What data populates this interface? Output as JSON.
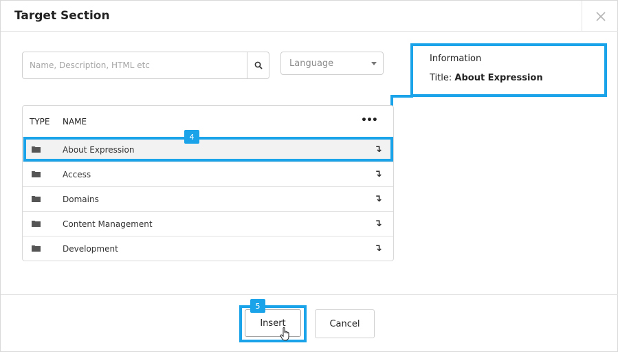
{
  "dialog": {
    "title": "Target Section"
  },
  "search": {
    "placeholder": "Name, Description, HTML etc"
  },
  "language": {
    "selected": "Language"
  },
  "info": {
    "heading": "Information",
    "title_label": "Title:",
    "title_value": "About Expression"
  },
  "table": {
    "columns": {
      "type": "TYPE",
      "name": "NAME",
      "more": "•••"
    },
    "rows": [
      {
        "name": "About Expression",
        "icon": "folder-icon",
        "selected": true
      },
      {
        "name": "Access",
        "icon": "folder-icon",
        "selected": false
      },
      {
        "name": "Domains",
        "icon": "folder-icon",
        "selected": false
      },
      {
        "name": "Content Management",
        "icon": "folder-icon",
        "selected": false
      },
      {
        "name": "Development",
        "icon": "folder-icon",
        "selected": false
      }
    ],
    "row_arrow": "↴"
  },
  "steps": {
    "row": "4",
    "insert": "5"
  },
  "footer": {
    "insert_label": "Insert",
    "cancel_label": "Cancel"
  },
  "colors": {
    "highlight": "#1aa3e8"
  }
}
